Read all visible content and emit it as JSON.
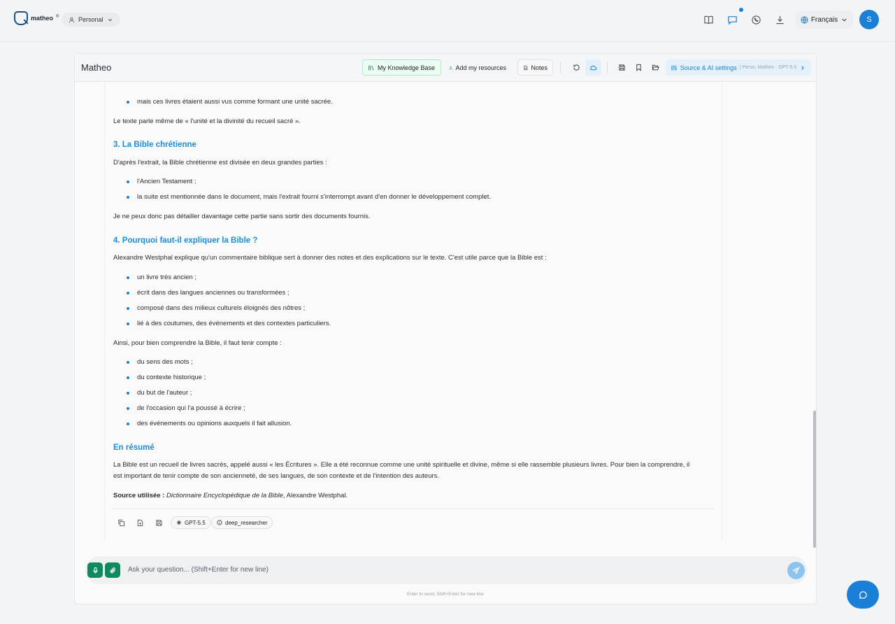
{
  "brand": {
    "name": "matheo",
    "mark": "®",
    "accent": "#1a7fd6",
    "green": "#0f8a5f"
  },
  "topbar": {
    "workspace": "Personal",
    "language": "Français",
    "avatar_initial": "S",
    "icons": [
      "book-icon",
      "chat-icon",
      "whatsapp-icon",
      "download-icon",
      "globe-icon"
    ]
  },
  "header": {
    "title": "Matheo",
    "knowledge_base": "My Knowledge Base",
    "add_resources": "Add my resources",
    "notes": "Notes",
    "settings": "Source & AI settings",
    "settings_meta": "| Perso, Matheo · GPT-5.5"
  },
  "doc": {
    "line_top": "mais ces livres étaient aussi vus comme formant une unité sacrée.",
    "p_unite": "Le texte parle même de « l'unité et la divinité du recueil sacré ».",
    "h3": "3. La Bible chrétienne",
    "p3": "D'après l'extrait, la Bible chrétienne est divisée en deux grandes parties :",
    "b3": [
      "l'Ancien Testament ;",
      "la suite est mentionnée dans le document, mais l'extrait fourni s'interrompt avant d'en donner le développement complet."
    ],
    "p3b": "Je ne peux donc pas détailler davantage cette partie sans sortir des documents fournis.",
    "h4": "4. Pourquoi faut-il expliquer la Bible ?",
    "p4": "Alexandre Westphal explique qu'un commentaire biblique sert à donner des notes et des explications sur le texte. C'est utile parce que la Bible est :",
    "b4": [
      "un livre très ancien ;",
      "écrit dans des langues anciennes ou transformées ;",
      "composé dans des milieux culturels éloignés des nôtres ;",
      "lié à des coutumes, des événements et des contextes particuliers."
    ],
    "p4b": "Ainsi, pour bien comprendre la Bible, il faut tenir compte :",
    "b4b": [
      "du sens des mots ;",
      "du contexte historique ;",
      "du but de l'auteur ;",
      "de l'occasion qui l'a poussé à écrire ;",
      "des événements ou opinions auxquels il fait allusion."
    ],
    "h5": "En résumé",
    "p5a": "La Bible est un recueil de livres sacrés, appelé aussi « les Écritures ». Elle a été reconnue comme une unité spirituelle et divine, même si elle rassemble plusieurs livres. Pour bien la comprendre, il",
    "p5b": "est important de tenir compte de son ancienneté, de ses langues, de son contexte et de l'intention des auteurs.",
    "source_label": "Source utilisée :",
    "source_title": "Dictionnaire Encyclopédique de la Bible",
    "source_author": ", Alexandre Westphal."
  },
  "actions": {
    "model": "GPT-5.5",
    "agent": "deep_researcher"
  },
  "input": {
    "placeholder": "Ask your question... (Shift+Enter for new line)",
    "hint": "Enter to send, Shift+Enter for new line"
  }
}
